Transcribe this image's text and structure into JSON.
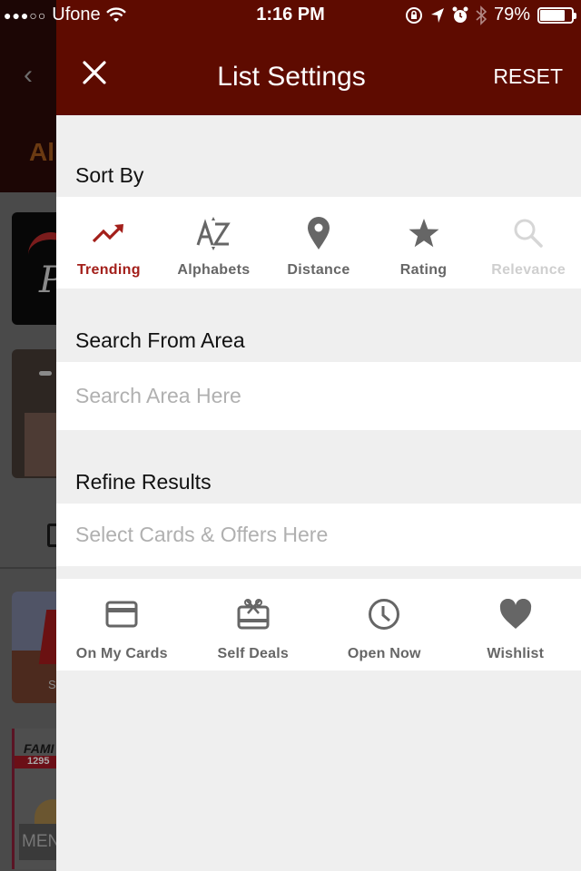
{
  "status_bar": {
    "signal_dots": "●●●○○",
    "carrier": "Ufone",
    "time": "1:16 PM",
    "battery_percent_label": "79%",
    "battery_level": 0.79,
    "icons": [
      "wifi-icon",
      "rotation-lock-icon",
      "location-icon",
      "alarm-icon",
      "bluetooth-icon",
      "battery-icon"
    ]
  },
  "background_app": {
    "back_glyph": "‹",
    "tab_label": "All",
    "card_brand_text": "Pi",
    "card3_text": "SO",
    "card4_title": "FAMI",
    "card4_price": "1295",
    "card4_button": "MEN"
  },
  "panel": {
    "title": "List Settings",
    "reset_label": "RESET",
    "sort_by": {
      "label": "Sort By",
      "options": [
        {
          "label": "Trending",
          "icon": "trending-icon",
          "state": "active"
        },
        {
          "label": "Alphabets",
          "icon": "alphabet-sort-icon",
          "state": "normal"
        },
        {
          "label": "Distance",
          "icon": "map-pin-icon",
          "state": "normal"
        },
        {
          "label": "Rating",
          "icon": "star-icon",
          "state": "normal"
        },
        {
          "label": "Relevance",
          "icon": "search-icon",
          "state": "disabled"
        }
      ]
    },
    "search_area": {
      "label": "Search From Area",
      "placeholder": "Search Area Here",
      "value": ""
    },
    "refine": {
      "label": "Refine Results",
      "placeholder": "Select Cards & Offers Here",
      "value": "",
      "filters": [
        {
          "label": "On My Cards",
          "icon": "credit-card-icon"
        },
        {
          "label": "Self Deals",
          "icon": "gift-card-icon"
        },
        {
          "label": "Open Now",
          "icon": "clock-icon"
        },
        {
          "label": "Wishlist",
          "icon": "heart-icon"
        }
      ]
    }
  },
  "colors": {
    "nav_bg": "#5e0b00",
    "accent": "#a31f1a",
    "icon_gray": "#666666",
    "disabled": "#cfcfcf",
    "panel_bg": "#efefef"
  }
}
